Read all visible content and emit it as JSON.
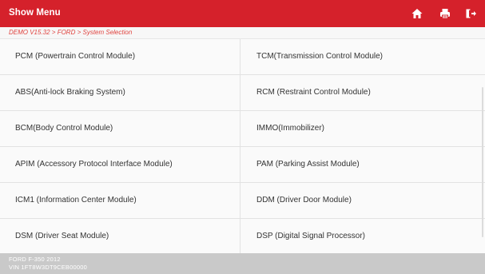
{
  "header": {
    "title": "Show Menu",
    "icons": [
      "home-icon",
      "print-icon",
      "exit-icon"
    ],
    "background": "#d5212b"
  },
  "breadcrumb": "DEMO V15.32 > FORD > System Selection",
  "modules": [
    {
      "left": "PCM (Powertrain Control Module)",
      "right": "TCM(Transmission Control Module)"
    },
    {
      "left": "ABS(Anti-lock Braking System)",
      "right": "RCM (Restraint Control Module)"
    },
    {
      "left": "BCM(Body Control Module)",
      "right": "IMMO(Immobilizer)"
    },
    {
      "left": "APIM (Accessory Protocol Interface Module)",
      "right": "PAM (Parking Assist Module)"
    },
    {
      "left": "ICM1 (Information Center Module)",
      "right": "DDM (Driver Door Module)"
    },
    {
      "left": "DSM (Driver Seat Module)",
      "right": "DSP (Digital Signal Processor)"
    }
  ],
  "footer": {
    "vehicle": "FORD F-350 2012",
    "vin": "VIN 1FT8W3DT9CEB00000"
  }
}
